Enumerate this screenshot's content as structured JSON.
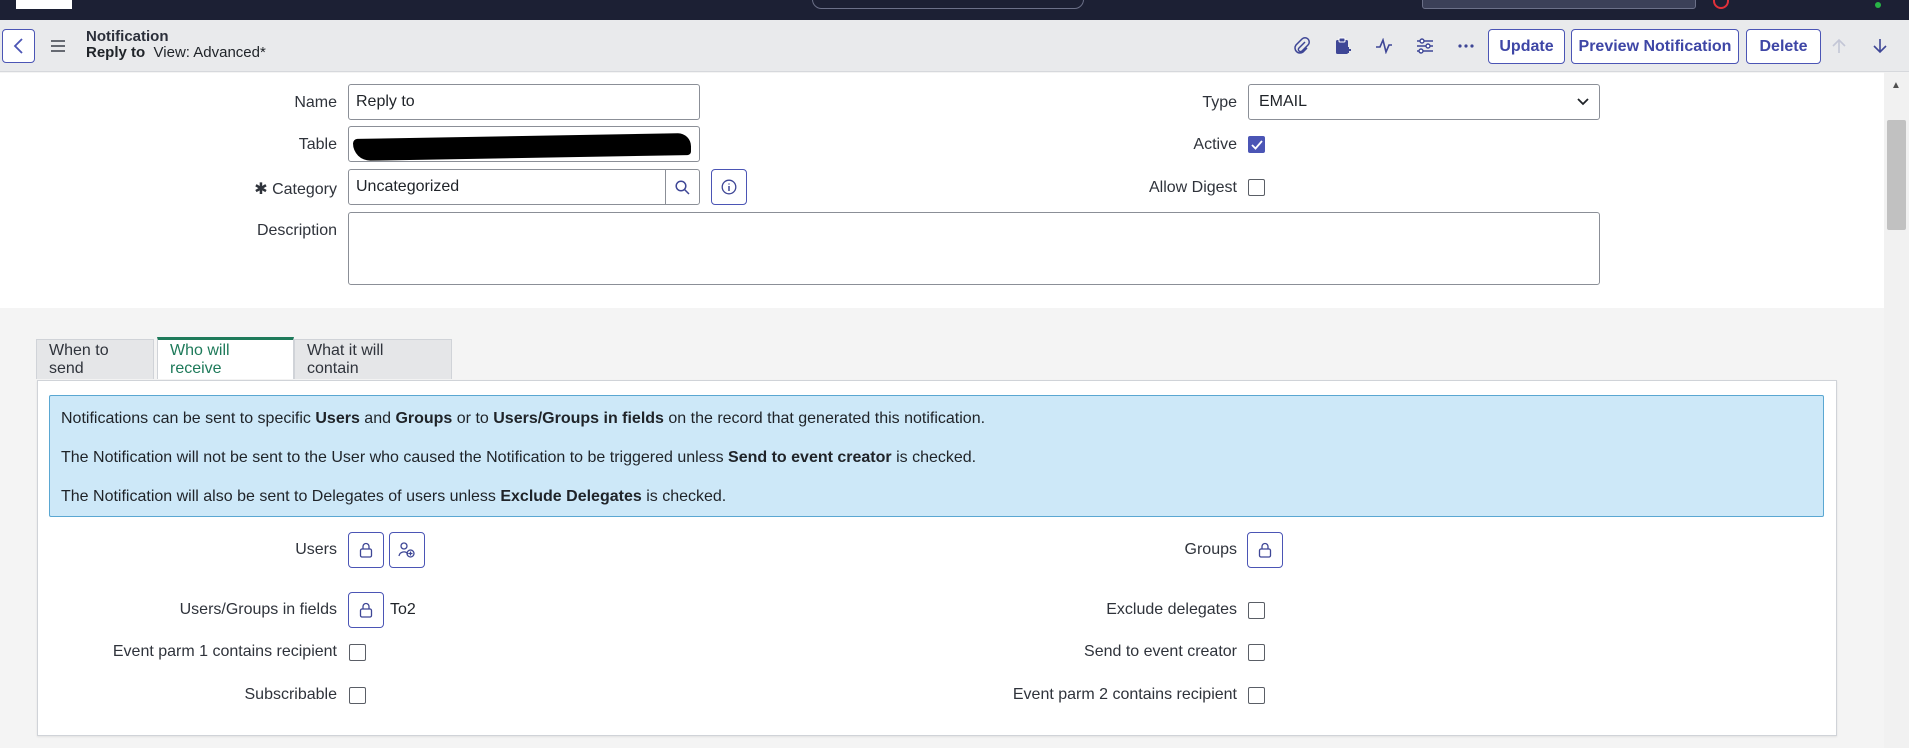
{
  "header": {
    "record_type": "Notification",
    "record_name": "Reply to",
    "view_label": "View: Advanced*",
    "buttons": {
      "update": "Update",
      "preview": "Preview Notification",
      "delete": "Delete"
    }
  },
  "form": {
    "name": {
      "label": "Name",
      "value": "Reply to"
    },
    "table": {
      "label": "Table",
      "value": ""
    },
    "category": {
      "label": "Category",
      "value": "Uncategorized",
      "required_mark": "✱"
    },
    "description": {
      "label": "Description",
      "value": ""
    },
    "type": {
      "label": "Type",
      "value": "EMAIL"
    },
    "active": {
      "label": "Active",
      "checked": true
    },
    "allow_digest": {
      "label": "Allow Digest",
      "checked": false
    }
  },
  "tabs": [
    {
      "label": "When to send"
    },
    {
      "label": "Who will receive"
    },
    {
      "label": "What it will contain"
    }
  ],
  "info": {
    "line1": {
      "a": "Notifications can be sent to specific ",
      "b": "Users",
      "c": " and ",
      "d": "Groups",
      "e": " or to ",
      "f": "Users/Groups in fields",
      "g": " on the record that generated this notification."
    },
    "line2": {
      "a": "The Notification will not be sent to the User who caused the Notification to be triggered unless ",
      "b": "Send to event creator",
      "c": " is checked."
    },
    "line3": {
      "a": "The Notification will also be sent to Delegates of users unless ",
      "b": "Exclude Delegates",
      "c": " is checked."
    }
  },
  "recipients": {
    "users": {
      "label": "Users"
    },
    "groups": {
      "label": "Groups"
    },
    "users_groups_in_fields": {
      "label": "Users/Groups in fields",
      "value": "To2"
    },
    "exclude_delegates": {
      "label": "Exclude delegates",
      "checked": false
    },
    "event_parm1": {
      "label": "Event parm 1 contains recipient",
      "checked": false
    },
    "send_to_event_creator": {
      "label": "Send to event creator",
      "checked": false
    },
    "subscribable": {
      "label": "Subscribable",
      "checked": false
    },
    "event_parm2": {
      "label": "Event parm 2 contains recipient",
      "checked": false
    }
  },
  "icons": {
    "back": "chevron-left-icon",
    "menu": "hamburger-icon",
    "attach": "paperclip-icon",
    "clipboard": "clipboard-icon",
    "activity": "activity-icon",
    "settings": "sliders-icon",
    "more": "ellipsis-icon",
    "up": "arrow-up-icon",
    "down": "arrow-down-icon",
    "search": "search-icon",
    "info": "info-icon",
    "lock": "lock-icon",
    "add_me": "add-me-icon"
  },
  "colors": {
    "accent": "#4b55b5",
    "tab_active": "#1e7a5a",
    "info_bg": "#cde8f8"
  }
}
